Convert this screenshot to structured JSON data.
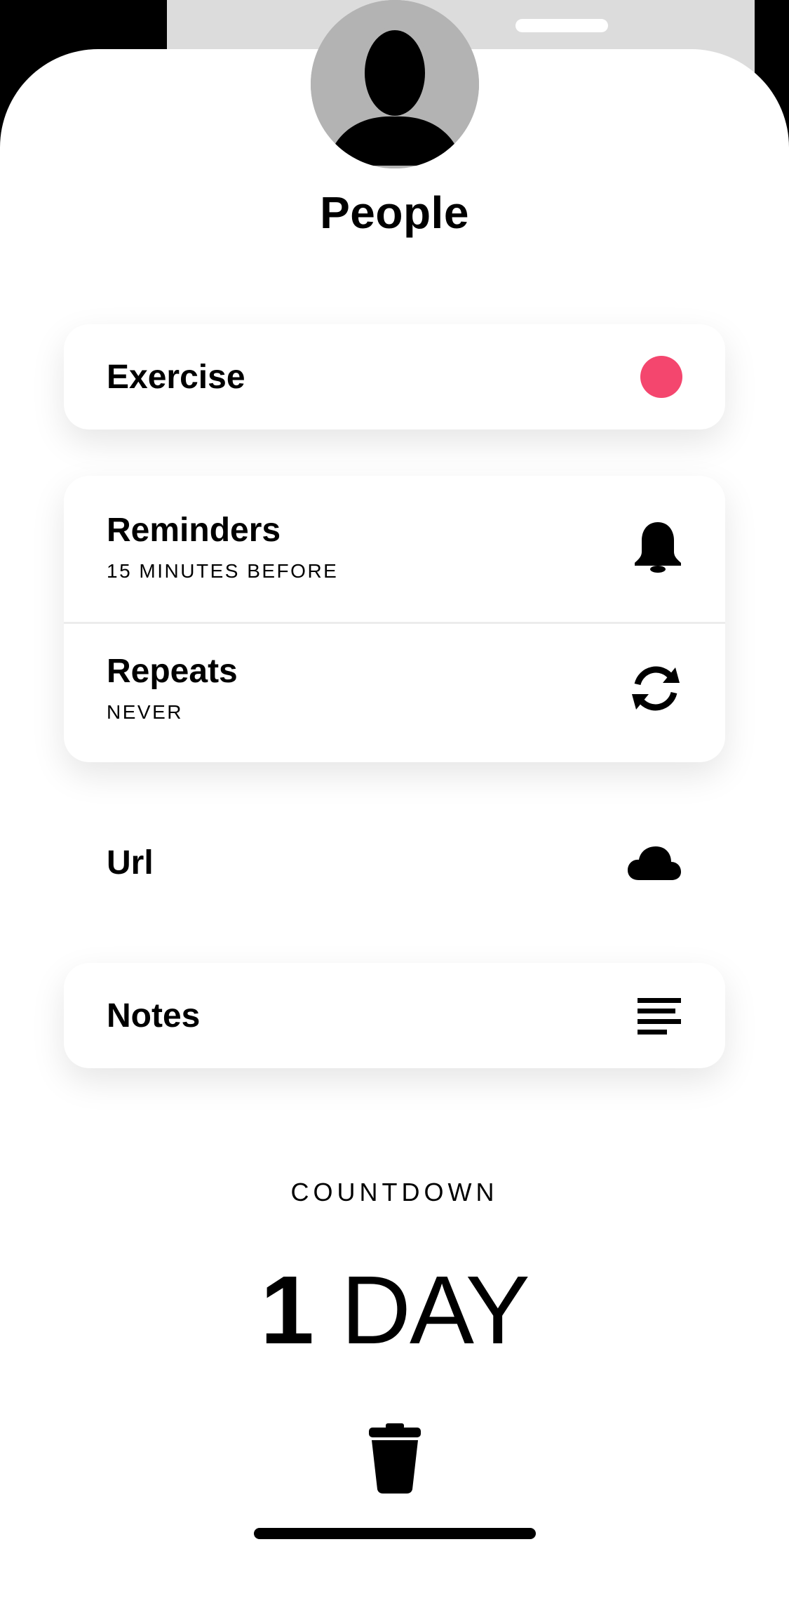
{
  "header": {
    "title": "People"
  },
  "items": {
    "calendar": {
      "label": "Exercise",
      "color": "#f4466e"
    },
    "reminders": {
      "label": "Reminders",
      "value": "15 MINUTES BEFORE",
      "icon": "bell-icon"
    },
    "repeats": {
      "label": "Repeats",
      "value": "NEVER",
      "icon": "refresh-icon"
    },
    "url": {
      "label": "Url",
      "icon": "cloud-icon"
    },
    "notes": {
      "label": "Notes",
      "icon": "text-align-icon"
    }
  },
  "countdown": {
    "label": "COUNTDOWN",
    "number": "1",
    "unit": "DAY"
  },
  "actions": {
    "delete_icon": "trash-icon"
  }
}
